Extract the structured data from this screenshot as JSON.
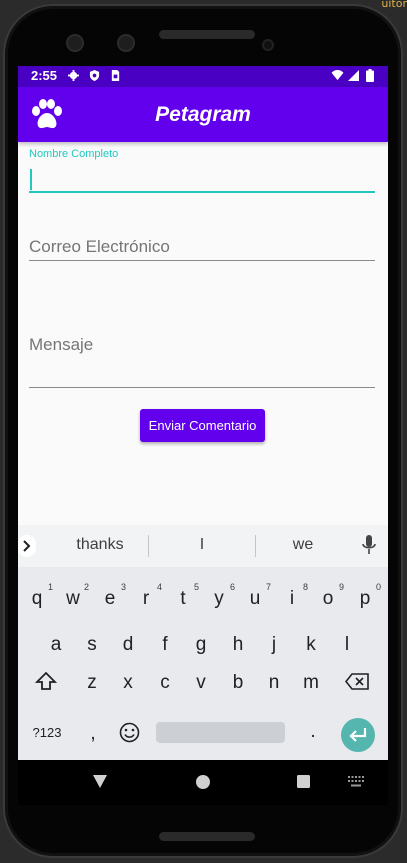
{
  "corner_text": "uitor",
  "status_bar": {
    "time": "2:55"
  },
  "app_bar": {
    "title": "Petagram",
    "logo_icon": "paw-icon"
  },
  "form": {
    "name_label": "Nombre Completo",
    "name_value": "",
    "email_placeholder": "Correo Electrónico",
    "message_placeholder": "Mensaje",
    "submit_label": "Enviar Comentario"
  },
  "keyboard": {
    "suggestions": [
      "thanks",
      "I",
      "we"
    ],
    "row1": [
      "q",
      "w",
      "e",
      "r",
      "t",
      "y",
      "u",
      "i",
      "o",
      "p"
    ],
    "row1_numbers": [
      "1",
      "2",
      "3",
      "4",
      "5",
      "6",
      "7",
      "8",
      "9",
      "0"
    ],
    "row2": [
      "a",
      "s",
      "d",
      "f",
      "g",
      "h",
      "j",
      "k",
      "l"
    ],
    "row3": [
      "z",
      "x",
      "c",
      "v",
      "b",
      "n",
      "m"
    ],
    "symbols_label": "?123",
    "comma": ",",
    "period": "."
  },
  "colors": {
    "primary": "#6200ee",
    "status_bar": "#4a00c2",
    "accent": "#1fc9c0"
  }
}
